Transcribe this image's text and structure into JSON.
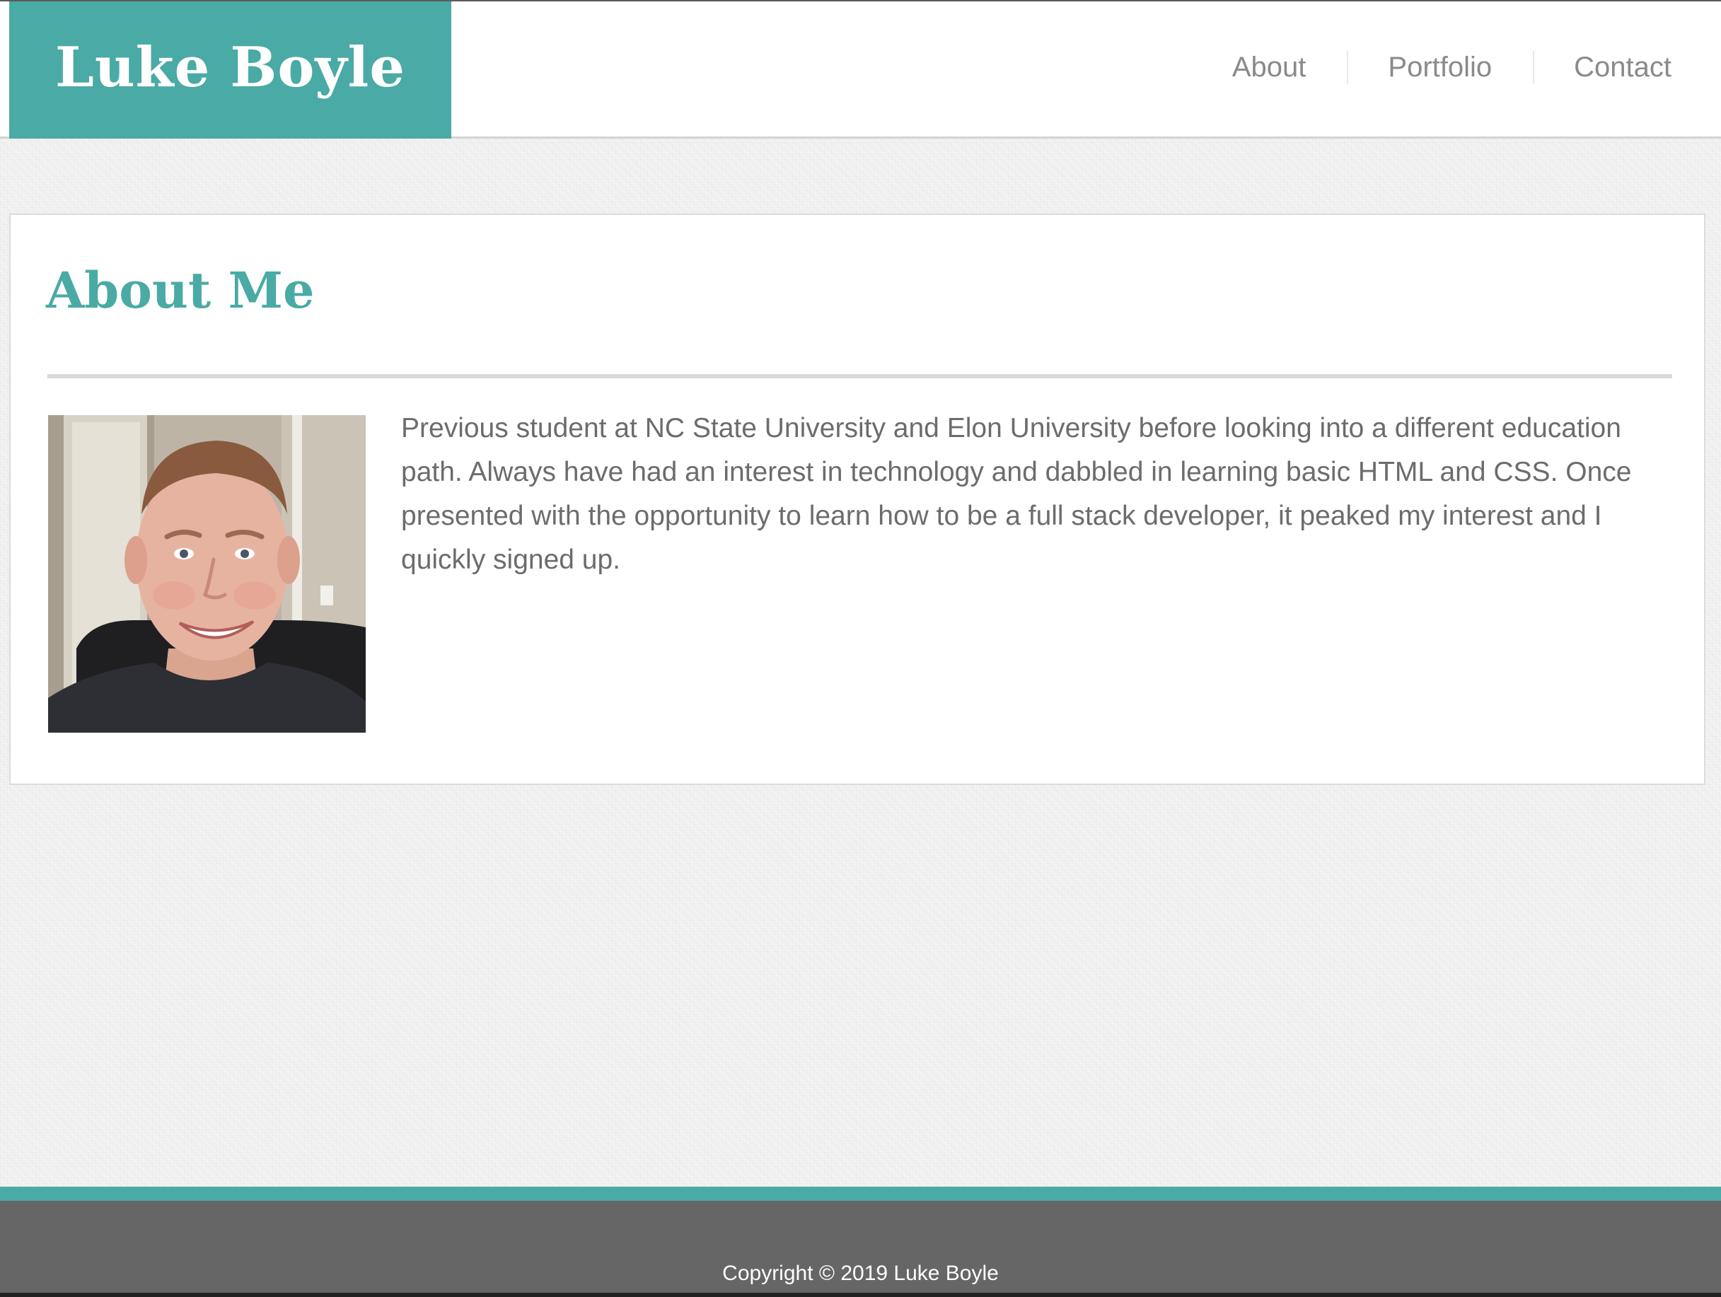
{
  "header": {
    "brand": "Luke Boyle",
    "nav": [
      {
        "label": "About"
      },
      {
        "label": "Portfolio"
      },
      {
        "label": "Contact"
      }
    ]
  },
  "about": {
    "title": "About Me",
    "photo_alt": "Portrait photo of Luke Boyle",
    "bio": "Previous student at NC State University and Elon University before looking into a different education path. Always have had an interest in technology and dabbled in learning basic HTML and CSS. Once presented with the opportunity to learn how to be a full stack developer, it peaked my interest and I quickly signed up."
  },
  "footer": {
    "copyright": "Copyright © 2019 Luke Boyle"
  },
  "colors": {
    "accent": "#4aaaa5",
    "nav_text": "#8a8a8a",
    "body_text": "#6c6c6c",
    "footer_bg": "#666666"
  }
}
